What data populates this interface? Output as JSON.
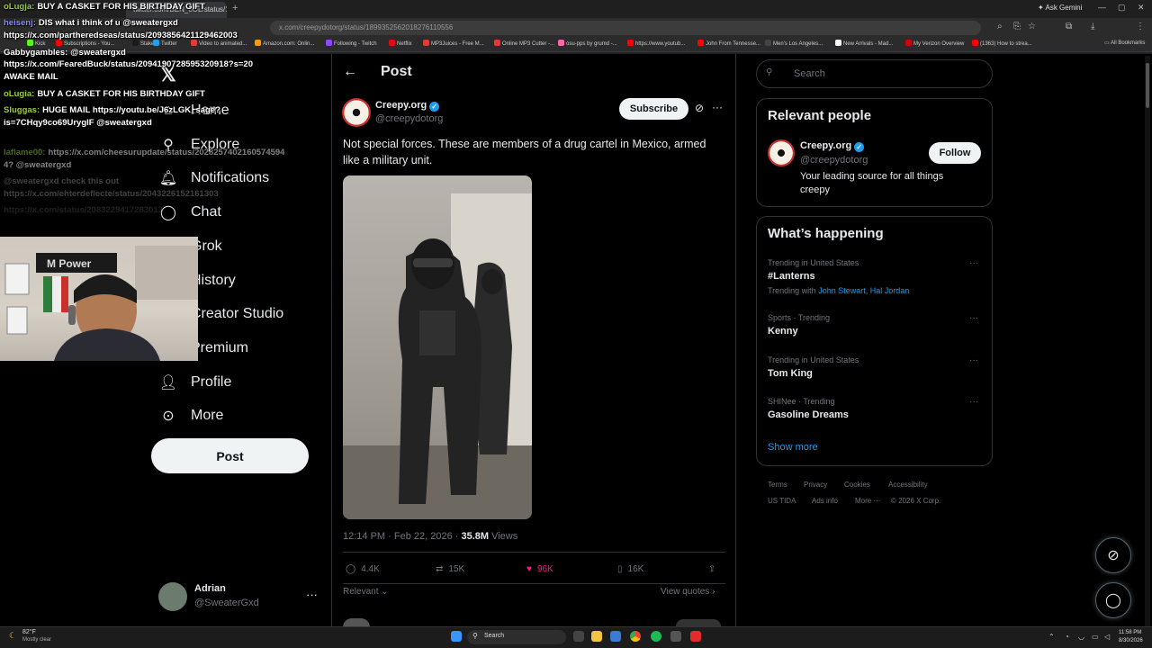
{
  "browser": {
    "tabs": [
      "twitter.com/BEN_0OL/status/1899352562018276110556",
      "Subscriptions - YouTube"
    ],
    "new_tab": "+",
    "ask_gemini": "Ask Gemini",
    "omnibox": "x.com/creepydotorg/status/1899352562018276110556",
    "bookmarks": [
      "Kick",
      "Subscriptions - You...",
      "Stake",
      "Twitter",
      "Video to animated...",
      "Amazon.com: Onlin...",
      "Following - Twitch",
      "Netflix",
      "MP3Juices - Free M...",
      "Online MP3 Cutter -...",
      "osu-pps by grumd -...",
      "https://www.youtub...",
      "John From Tennesse...",
      "Men's Los Angeles...",
      "New Arrivals - Mad...",
      "My Verizon Overview",
      "(1363) How to strea..."
    ],
    "bookmark_colors": [
      "#53fc18",
      "#ff0000",
      "#1a1a1a",
      "#1da1f2",
      "#e53935",
      "#ff9900",
      "#9146ff",
      "#e50914",
      "#e53935",
      "#e53935",
      "#ff66aa",
      "#ff0000",
      "#ff0000",
      "#444444",
      "#ffffff",
      "#cd040b",
      "#ff0000"
    ],
    "all_bookmarks": "All Bookmarks"
  },
  "chat": [
    {
      "user": "oLugja:",
      "color": "#9acd32",
      "text": "BUY A CASKET FOR HIS BIRTHDAY GIFT",
      "fade": ""
    },
    {
      "user": "heisenj:",
      "color": "#8a8aff",
      "text": "DIS what i think of u @sweatergxd",
      "fade": ""
    },
    {
      "user": "",
      "color": "#ffffff",
      "text": "https://x.com/partheredseas/status/2093856421129462003",
      "fade": ""
    },
    {
      "user": "Gabbygambles:",
      "color": "#ffffff",
      "text": "@sweatergxd",
      "fade": ""
    },
    {
      "user": "",
      "color": "#ffffff",
      "text": "https://x.com/FearedBuck/status/2094190728595320918?s=20",
      "fade": ""
    },
    {
      "user": "",
      "color": "#ffffff",
      "text": "AWAKE MAIL",
      "fade": ""
    },
    {
      "user": "oLugia:",
      "color": "#9acd32",
      "text": "BUY A CASKET FOR HIS BIRTHDAY GIFT",
      "fade": ""
    },
    {
      "user": "Sluggas:",
      "color": "#9acd32",
      "text": "HUGE MAIL https://youtu.be/J6zLGK_sage?",
      "fade": ""
    },
    {
      "user": "",
      "color": "#ffffff",
      "text": "is=7CHqy9co69UrygIF @sweatergxd",
      "fade": ""
    },
    {
      "user": "laflame00:",
      "color": "#9acd32",
      "text": "https://x.com/cheesurupdate/status/2028257402160574594",
      "fade": "fade1"
    },
    {
      "user": "",
      "color": "#ffffff",
      "text": "4? @sweatergxd",
      "fade": "fade1"
    },
    {
      "user": "",
      "color": "#ffffff",
      "text": "@sweatergxd check this out",
      "fade": "fade2"
    },
    {
      "user": "",
      "color": "#ffffff",
      "text": "https://x.com/ehterdeflecte/status/2043226152161303",
      "fade": "fade2"
    },
    {
      "user": "",
      "color": "#ffffff",
      "text": "https://x.com/status/2083229417283013",
      "fade": "fade3"
    }
  ],
  "nav": {
    "home": "Home",
    "explore": "Explore",
    "notifications": "Notifications",
    "chat": "Chat",
    "grok": "Grok",
    "history": "History",
    "creator_studio": "Creator Studio",
    "premium": "Premium",
    "profile": "Profile",
    "more": "More",
    "post_button": "Post",
    "account_name": "Adrian",
    "account_handle": "@SweaterGxd"
  },
  "post": {
    "heading": "Post",
    "author_name": "Creepy.org",
    "author_handle": "@creepydotorg",
    "subscribe": "Subscribe",
    "text": "Not special forces. These are members of a drug cartel in Mexico, armed like a military unit.",
    "time": "12:14 PM · Feb 22, 2026 · ",
    "views_count": "35.8M",
    "views_label": " Views",
    "replies": "4.4K",
    "reposts": "15K",
    "likes": "96K",
    "bookmarks": "16K",
    "sort": "Relevant",
    "view_quotes": "View quotes"
  },
  "sidebar": {
    "search_placeholder": "Search",
    "relevant_title": "Relevant people",
    "rp_name": "Creepy.org",
    "rp_handle": "@creepydotorg",
    "rp_bio": "Your leading source for all things creepy",
    "follow": "Follow",
    "happening_title": "What’s happening",
    "trends": [
      {
        "meta": "Trending in United States",
        "name": "#Lanterns",
        "with_label": "Trending with ",
        "with_links": "John Stewart, Hal Jordan"
      },
      {
        "meta": "Sports · Trending",
        "name": "Kenny"
      },
      {
        "meta": "Trending in United States",
        "name": "Tom King"
      },
      {
        "meta": "SHINee · Trending",
        "name": "Gasoline Dreams"
      }
    ],
    "show_more": "Show more",
    "footer": [
      "Terms",
      "Privacy",
      "Cookies",
      "Accessibility",
      "US TIDA",
      "Ads info",
      "More ···",
      "© 2026 X Corp."
    ]
  },
  "taskbar": {
    "temp": "82°F",
    "weather": "Mostly clear",
    "search": "Search",
    "time": "11:58 PM",
    "date": "8/30/2026"
  }
}
